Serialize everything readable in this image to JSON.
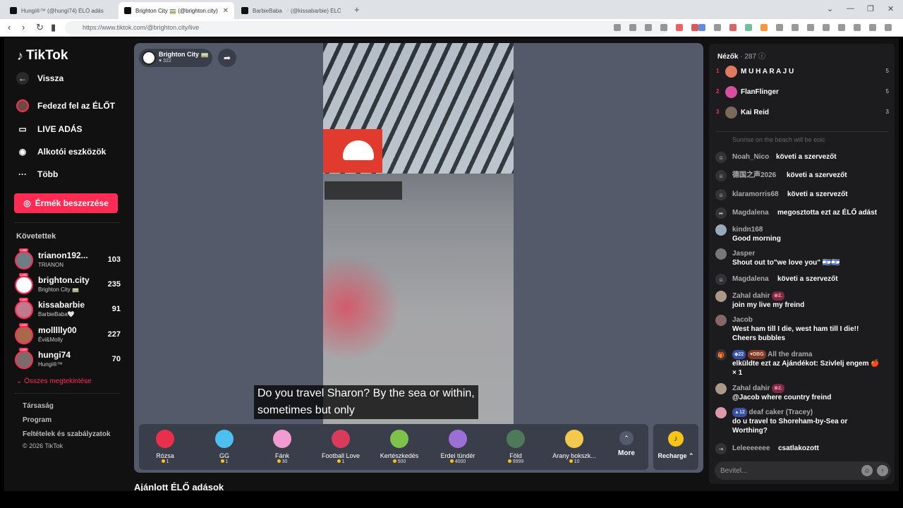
{
  "browser": {
    "tabs": [
      {
        "title": "Hungi®™ (@hungi74) ÉLŐ adás"
      },
      {
        "title": "Brighton City 🚃 (@brighton.city)"
      },
      {
        "title": "BarbieBaba🤍 (@kissabarbie) ÉLŐ a"
      }
    ],
    "url": "https://www.tiktok.com/@brighton.city/live"
  },
  "sidebar": {
    "logo": "TikTok",
    "nav": [
      {
        "label": "Vissza",
        "icon": "arrow-left-icon"
      },
      {
        "label": "Fedezd fel az ÉLŐT",
        "icon": "live-avatar-icon"
      },
      {
        "label": "LIVE ADÁS",
        "icon": "video-camera-icon"
      },
      {
        "label": "Alkotói eszközök",
        "icon": "creator-tools-icon"
      },
      {
        "label": "Több",
        "icon": "more-dots-icon"
      }
    ],
    "coins_button": "Érmék beszerzése",
    "following_header": "Követettek",
    "following": [
      {
        "name": "trianon192...",
        "sub": "TRIANON",
        "count": "103"
      },
      {
        "name": "brighton.city",
        "sub": "Brighton City 🚃",
        "count": "235"
      },
      {
        "name": "kissabarbie",
        "sub": "BarbieBaba🤍",
        "count": "91"
      },
      {
        "name": "mollllly00",
        "sub": "Évi&Molly",
        "count": "227"
      },
      {
        "name": "hungi74",
        "sub": "Hungi®™",
        "count": "70"
      }
    ],
    "see_all": "Összes megtekintése",
    "footer": [
      "Társaság",
      "Program",
      "Feltételek és szabályzatok",
      "© 2026 TikTok"
    ]
  },
  "player": {
    "host_name": "Brighton City 🚃",
    "likes": "322",
    "subtitle_line1": "Do you travel Sharon? By the sea or within,",
    "subtitle_line2": "sometimes but only"
  },
  "gifts": [
    {
      "name": "Rózsa",
      "price": "1",
      "color": "#e8304c"
    },
    {
      "name": "GG",
      "price": "1",
      "color": "#4cc0f0"
    },
    {
      "name": "Fánk",
      "price": "30",
      "color": "#f29bd0"
    },
    {
      "name": "Football Love",
      "price": "1",
      "color": "#d93c5a"
    },
    {
      "name": "Kertészkedés",
      "price": "500",
      "color": "#7fc24a"
    },
    {
      "name": "Erdei tündér",
      "price": "4000",
      "color": "#9b6fd6"
    },
    {
      "name": "Föld",
      "price": "9999",
      "color": "#4e7a5a"
    },
    {
      "name": "Arany bokszk...",
      "price": "10",
      "color": "#f2c94c"
    }
  ],
  "more_label": "More",
  "recharge_label": "Recharge",
  "recommended_title": "Ajánlott ÉLŐ adások",
  "chat": {
    "viewers_label": "Nézők",
    "viewers_count": "287",
    "top_viewers": [
      {
        "rank": "1",
        "name": "M U H A R A J U",
        "score": "5",
        "color": "#e07a5f"
      },
      {
        "rank": "2",
        "name": "FlanFlinger",
        "score": "5",
        "color": "#d94fa0"
      },
      {
        "rank": "3",
        "name": "Kai Reid",
        "score": "3",
        "color": "#7a6a5a"
      }
    ],
    "faded": "Sunrise on the beach will be epic",
    "messages": [
      {
        "user": "Noah_Nico",
        "text": "követi a szervezőt"
      },
      {
        "user": "德国之声2026",
        "text": "követi a szervezőt"
      },
      {
        "user": "klaramorris68",
        "text": "követi a szervezőt"
      },
      {
        "user": "Magdalena",
        "text": "megosztotta ezt az ÉLŐ adást"
      },
      {
        "user": "kindn168",
        "text": "Good morning"
      },
      {
        "user": "Jasper",
        "text": "Shout out to\"we love you\" 🇮🇱🇮🇱"
      },
      {
        "user": "Magdalena",
        "text": "követi a szervezőt"
      },
      {
        "user": "Zahal dahir",
        "badge": "2",
        "text": "join my live my freind"
      },
      {
        "user": "Jacob",
        "text": "West ham till I die, west ham till I die!! Cheers bubbles"
      },
      {
        "user": "All the drama",
        "badge1": "22",
        "badge2": "DBG",
        "text": "elküldte ezt az Ajándékot: Szivlelj engem 🍎 × 1"
      },
      {
        "user": "Zahal dahir",
        "badge": "2",
        "text": "@Jacob where country freind"
      },
      {
        "user": "deaf caker (Tracey)",
        "badge": "12",
        "text": "do u travel to Shoreham-by-Sea or Worthing?"
      },
      {
        "user": "Leleeeeeee",
        "text": "csatlakozott"
      }
    ],
    "input_placeholder": "Bevitel..."
  }
}
